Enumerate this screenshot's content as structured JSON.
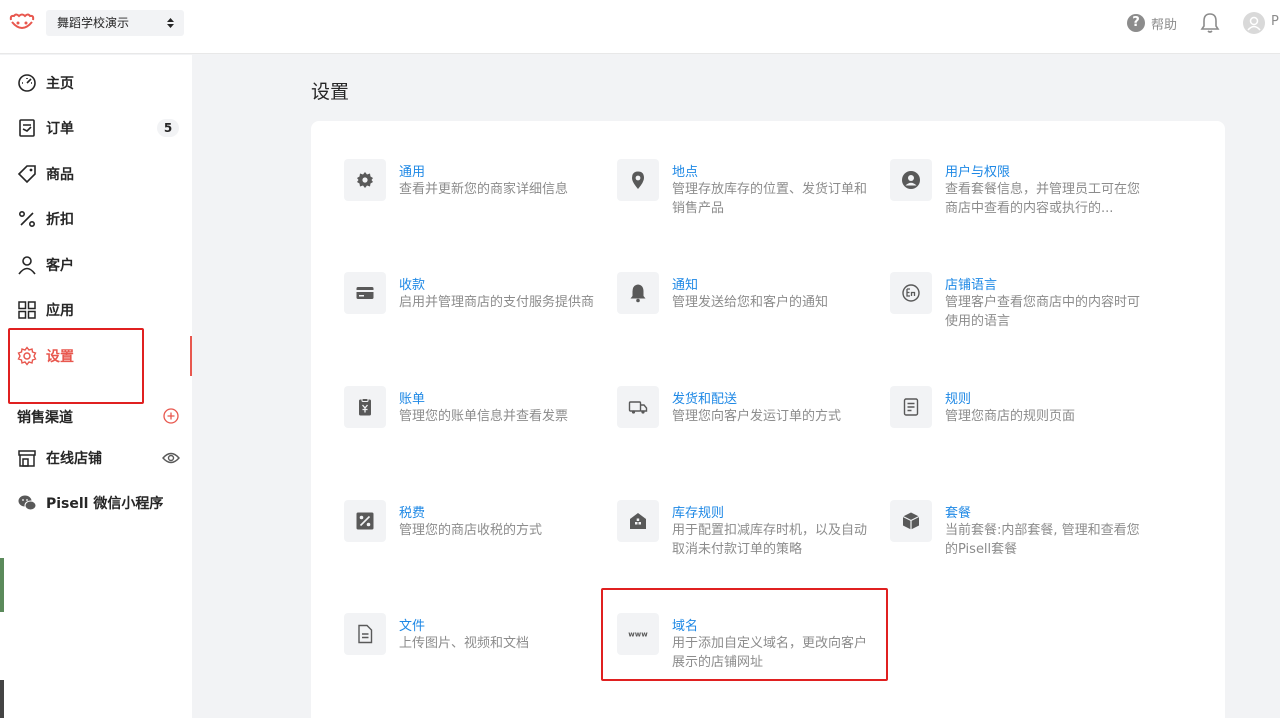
{
  "header": {
    "store_name": "舞蹈学校演示",
    "help_label": "帮助",
    "avatar_letter": "P"
  },
  "sidebar": {
    "items": [
      {
        "label": "主页",
        "icon": "dashboard-icon"
      },
      {
        "label": "订单",
        "icon": "orders-icon",
        "badge": "5"
      },
      {
        "label": "商品",
        "icon": "tag-icon"
      },
      {
        "label": "折扣",
        "icon": "percent-icon"
      },
      {
        "label": "客户",
        "icon": "user-icon"
      },
      {
        "label": "应用",
        "icon": "apps-icon"
      },
      {
        "label": "设置",
        "icon": "gear-icon",
        "active": true
      }
    ],
    "section_title": "销售渠道",
    "channels": [
      {
        "label": "在线店铺",
        "icon": "store-icon"
      },
      {
        "label": "Pisell 微信小程序",
        "icon": "wechat-icon"
      }
    ]
  },
  "main": {
    "title": "设置",
    "tiles": [
      {
        "title": "通用",
        "desc": "查看并更新您的商家详细信息",
        "icon": "gear-icon"
      },
      {
        "title": "地点",
        "desc": "管理存放库存的位置、发货订单和销售产品",
        "icon": "location-icon"
      },
      {
        "title": "用户与权限",
        "desc": "查看套餐信息，并管理员工可在您商店中查看的内容或执行的...",
        "icon": "user-circle-icon"
      },
      {
        "title": "收款",
        "desc": "启用并管理商店的支付服务提供商",
        "icon": "credit-card-icon"
      },
      {
        "title": "通知",
        "desc": "管理发送给您和客户的通知",
        "icon": "bell-icon"
      },
      {
        "title": "店铺语言",
        "desc": "管理客户查看您商店中的内容时可使用的语言",
        "icon": "language-icon"
      },
      {
        "title": "账单",
        "desc": "管理您的账单信息并查看发票",
        "icon": "bill-icon"
      },
      {
        "title": "发货和配送",
        "desc": "管理您向客户发运订单的方式",
        "icon": "truck-icon"
      },
      {
        "title": "规则",
        "desc": "管理您商店的规则页面",
        "icon": "rules-icon"
      },
      {
        "title": "税费",
        "desc": "管理您的商店收税的方式",
        "icon": "tax-icon"
      },
      {
        "title": "库存规则",
        "desc": "用于配置扣减库存时机，以及自动取消未付款订单的策略",
        "icon": "warehouse-icon"
      },
      {
        "title": "套餐",
        "desc": "当前套餐:内部套餐, 管理和查看您的Pisell套餐",
        "icon": "package-icon"
      },
      {
        "title": "文件",
        "desc": "上传图片、视频和文档",
        "icon": "file-icon"
      },
      {
        "title": "域名",
        "desc": "用于添加自定义域名，更改向客户展示的店铺网址",
        "icon": "domain-icon"
      }
    ]
  },
  "colors": {
    "accent": "#e8574e",
    "link": "#1e88e5",
    "highlight_box": "#e02020"
  }
}
